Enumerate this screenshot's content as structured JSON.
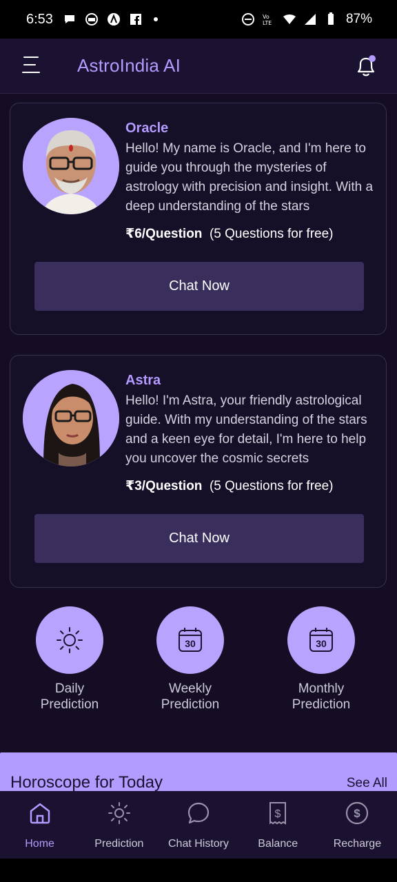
{
  "status_bar": {
    "time": "6:53",
    "battery": "87%"
  },
  "app": {
    "title": "AstroIndia AI"
  },
  "astrologers": [
    {
      "name": "Oracle",
      "description": "Hello! My name is Oracle, and I'm here to guide you through the mysteries of astrology with precision and insight. With a deep understanding of the stars",
      "price": "₹6/Question",
      "free": "(5 Questions for free)",
      "cta": "Chat Now"
    },
    {
      "name": "Astra",
      "description": "Hello! I'm Astra, your friendly astrological guide. With my understanding of the stars and a keen eye for detail, I'm here to help you uncover the cosmic secrets",
      "price": "₹3/Question",
      "free": "(5 Questions for free)",
      "cta": "Chat Now"
    }
  ],
  "predictions": [
    {
      "line1": "Daily",
      "line2": "Prediction",
      "icon": "sun-icon"
    },
    {
      "line1": "Weekly",
      "line2": "Prediction",
      "icon": "calendar-30-icon",
      "day": "30"
    },
    {
      "line1": "Monthly",
      "line2": "Prediction",
      "icon": "calendar-30-icon",
      "day": "30"
    }
  ],
  "horoscope": {
    "title": "Horoscope for Today",
    "see_all": "See All"
  },
  "nav": [
    {
      "label": "Home",
      "icon": "home-icon",
      "active": true
    },
    {
      "label": "Prediction",
      "icon": "sun-icon"
    },
    {
      "label": "Chat History",
      "icon": "chat-bubble-icon"
    },
    {
      "label": "Balance",
      "icon": "receipt-icon"
    },
    {
      "label": "Recharge",
      "icon": "dollar-circle-icon"
    }
  ],
  "colors": {
    "background": "#140d24",
    "accent": "#b49bff",
    "button": "#3a2e5c"
  }
}
